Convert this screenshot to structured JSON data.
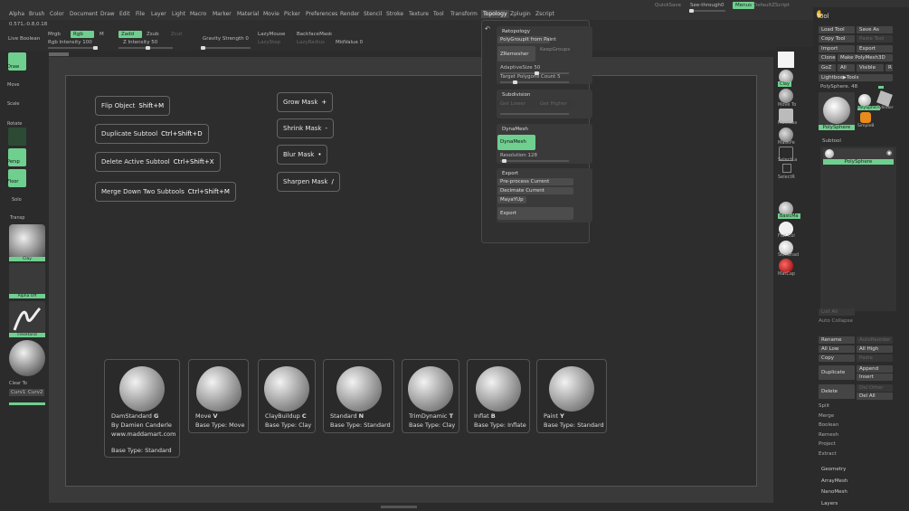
{
  "menu": [
    "Alpha",
    "Brush",
    "Color",
    "Document",
    "Draw",
    "Edit",
    "File",
    "Layer",
    "Light",
    "Macro",
    "Marker",
    "Material",
    "Movie",
    "Picker",
    "Preferences",
    "Render",
    "Stencil",
    "Stroke",
    "Texture",
    "Tool",
    "Transform",
    "Topology",
    "Zplugin",
    "Zscript"
  ],
  "menu_active": "Topology",
  "topright": {
    "quicksave": "QuickSave",
    "seethrough": "See-through",
    "seethrough_val": "0",
    "menus": "Menus",
    "defaultzscript": "DefaultZScript"
  },
  "status": {
    "coords": "0.571,-0.8,0.18",
    "live_boolean": "Live Boolean"
  },
  "topbar": {
    "mrgb": "Mrgb",
    "rgb": "Rgb",
    "m": "M",
    "zadd": "Zadd",
    "zsub": "Zsub",
    "zcut": "Zcut",
    "rgb_intensity": "Rgb Intensity 100",
    "z_intensity": "Z Intensity 50",
    "gravity": "Gravity Strength 0",
    "lazymouse": "LazyMouse",
    "lazystep": "LazyStep",
    "backfacemask": "BackfaceMask",
    "lazyradius": "LazyRadius",
    "midvalue": "MidValue 0"
  },
  "lefttools": {
    "draw": "Draw",
    "move": "Move",
    "scale": "Scale",
    "rotate": "Rotate",
    "persp": "Persp",
    "floor": "Floor",
    "solo": "Solo",
    "transp": "Transp",
    "clay": "Clay",
    "alpha_off": "Alpha Off",
    "freehand": "FreeHand",
    "clear_to": "Clear To",
    "curv1": "Curv1",
    "curv2": "Curv2"
  },
  "hints": [
    {
      "label": "Flip Object",
      "key": "Shift+M"
    },
    {
      "label": "Duplicate Subtool",
      "key": "Ctrl+Shift+D"
    },
    {
      "label": "Delete Active Subtool",
      "key": "Ctrl+Shift+X"
    },
    {
      "label": "Merge Down Two Subtools",
      "key": "Ctrl+Shift+M"
    },
    {
      "label": "Grow Mask",
      "key": "+"
    },
    {
      "label": "Shrink Mask",
      "key": "-"
    },
    {
      "label": "Blur Mask",
      "key": "•"
    },
    {
      "label": "Sharpen Mask",
      "key": "/"
    }
  ],
  "brushes": [
    {
      "name": "DamStandard",
      "key": "G",
      "l2": "By Damien Canderle",
      "l3": "www.maddamart.com",
      "l4": "Base Type: Standard"
    },
    {
      "name": "Move",
      "key": "V",
      "l2": "Base Type: Move"
    },
    {
      "name": "ClayBuildup",
      "key": "C",
      "l2": "Base Type: Clay"
    },
    {
      "name": "Standard",
      "key": "N",
      "l2": "Base Type: Standard"
    },
    {
      "name": "TrimDynamic",
      "key": "T",
      "l2": "Base Type: Clay"
    },
    {
      "name": "Inflat",
      "key": "B",
      "l2": "Base Type: Inflate"
    },
    {
      "name": "Paint",
      "key": "Y",
      "l2": "Base Type: Standard"
    }
  ],
  "topology": {
    "retopology": "Retopology",
    "polygroupit": "PolyGroupIt from Paint",
    "zremesher": "ZRemesher",
    "keepgroups": "KeepGroups",
    "adaptivesize": "AdaptiveSize 50",
    "target_poly": "Target Polygons Count 5",
    "subdivision": "Subdivision",
    "get_lower": "Get Lower",
    "get_higher": "Get Higher",
    "dynamesh": "DynaMesh",
    "dynamesh_btn": "DynaMesh",
    "resolution": "Resolution 128",
    "export": "Export",
    "preprocess": "Pre-process Current",
    "decimate": "Decimate Current",
    "mayayup": "MayaYUp",
    "export_btn": "Export"
  },
  "rightstrip": {
    "clay": "Clay",
    "move_to": "Move To",
    "masklasso": "MaskLas",
    "maskpen": "MaskPe",
    "selectlasso": "SelectLa",
    "selectrect": "SelectR",
    "basicmat": "BasicMa",
    "flatcolor": "Flat Col",
    "skinshade": "SkinShad",
    "matcap": "MatCap"
  },
  "tool": {
    "title": "Tool",
    "load": "Load Tool",
    "saveas": "Save As",
    "copy": "Copy Tool",
    "paste": "Paste Tool",
    "import": "Import",
    "export": "Export",
    "clone": "Clone",
    "makepolymesh": "Make PolyMesh3D",
    "goz": "GoZ",
    "all": "All",
    "visible": "Visible",
    "r": "R",
    "lightbox": "Lightbox▶Tools",
    "polysphere_count": "PolySphere. 48",
    "polysphere": "PolySphere",
    "cylinder": "Cylinder",
    "simpleb": "SimpleB",
    "subtool": "Subtool",
    "subtool_item": "PolySphere",
    "listall": "List All",
    "autocollapse": "Auto Collapse",
    "rename": "Rename",
    "autoreorder": "AutoReorder",
    "alllow": "All Low",
    "allhigh": "All High",
    "copy2": "Copy",
    "paste2": "Paste",
    "duplicate": "Duplicate",
    "append": "Append",
    "insert": "Insert",
    "delete": "Delete",
    "delother": "Del Other",
    "delall": "Del All",
    "split": "Split",
    "merge": "Merge",
    "boolean": "Boolean",
    "remesh": "Remesh",
    "project": "Project",
    "extract": "Extract",
    "geometry": "Geometry",
    "arraymesh": "ArrayMesh",
    "nanomesh": "NanoMesh",
    "layers": "Layers"
  },
  "colors": {
    "accent": "#6fcf8f"
  }
}
